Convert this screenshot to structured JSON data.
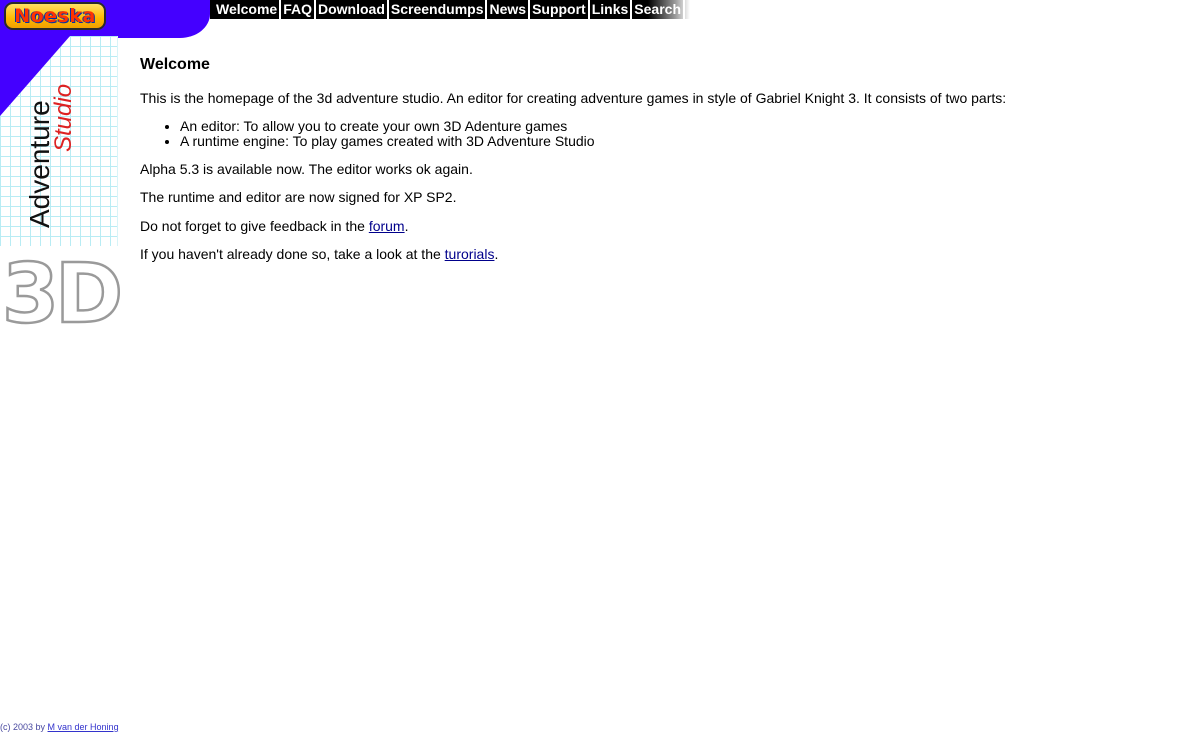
{
  "logo": {
    "text": "Noeska"
  },
  "nav": [
    {
      "label": "Welcome"
    },
    {
      "label": "FAQ"
    },
    {
      "label": "Download"
    },
    {
      "label": "Screendumps"
    },
    {
      "label": "News"
    },
    {
      "label": "Support"
    },
    {
      "label": "Links"
    },
    {
      "label": "Search"
    }
  ],
  "sidebar": {
    "word1": "Adventure",
    "word2": "Studio",
    "badge": "3D",
    "colors": {
      "accent_blue": "#4400ff",
      "grid_cyan": "#b8ecf4",
      "studio_red": "#dd2222"
    }
  },
  "main": {
    "title": "Welcome",
    "intro": "This is the homepage of the 3d adventure studio. An editor for creating adventure games in style of Gabriel Knight 3. It consists of two parts:",
    "parts": [
      "An editor: To allow you to create your own 3D Adenture games",
      "A runtime engine: To play games created with 3D Adventure Studio"
    ],
    "alpha": "Alpha 5.3 is available now. The editor works ok again.",
    "signed": "The runtime and editor are now signed for XP SP2.",
    "feedback_prefix": "Do not forget to give feedback in the ",
    "feedback_link": "forum",
    "feedback_suffix": ".",
    "tutorial_prefix": "If you haven't already done so, take a look at the ",
    "tutorial_link": "turorials",
    "tutorial_suffix": "."
  },
  "footer": {
    "prefix": "(c) 2003 by ",
    "author_link": "M van der Honing"
  }
}
